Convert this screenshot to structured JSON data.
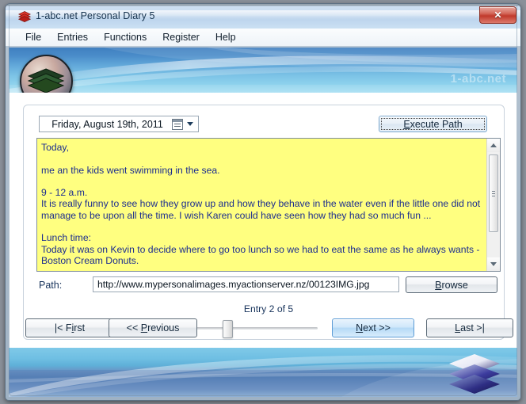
{
  "window": {
    "title": "1-abc.net Personal Diary 5",
    "app_icon": "stacked-layers-icon",
    "close_label": "✕"
  },
  "menubar": {
    "items": [
      {
        "label": "File"
      },
      {
        "label": "Entries"
      },
      {
        "label": "Functions"
      },
      {
        "label": "Register"
      },
      {
        "label": "Help"
      }
    ]
  },
  "banner": {
    "watermark": "1-abc.net",
    "logo_icon": "stacked-layers-logo"
  },
  "toolbar": {
    "date_value": "Friday, August 19th, 2011",
    "calendar_icon": "calendar-icon",
    "dropdown_icon": "chevron-down-icon",
    "execute_path_label": "Execute Path"
  },
  "editor": {
    "content": "Today,\n\nme an the kids went swimming in the sea.\n\n9 - 12 a.m.\nIt is really funny to see how they grow up and how they behave in the water even if the little one did not manage to be upon all the time. I wish Karen could have seen how they had so much fun ...\n\nLunch time:\nToday it was on Kevin to decide where to go too lunch so we had to eat the same as he always wants - Boston Cream Donuts.",
    "background_color": "#ffff80",
    "text_color": "#1c2d8f",
    "scroll_up_icon": "arrow-up-icon",
    "scroll_down_icon": "arrow-down-icon"
  },
  "path_row": {
    "label": "Path:",
    "value": "http://www.mypersonalimages.myactionserver.nz/00123IMG.jpg",
    "browse_label": "Browse"
  },
  "navigation": {
    "entry_status": "Entry 2 of 5",
    "current_entry": 2,
    "total_entries": 5,
    "slider_percent": 26,
    "first_label": "|< First",
    "previous_label": "<< Previous",
    "next_label": "Next >>",
    "last_label": "Last >|"
  },
  "colors": {
    "editor_bg": "#ffff80",
    "editor_text": "#1c2d8f",
    "default_button": "#5b9bd5",
    "close_button": "#c0392b",
    "banner_blue": "#63a9da"
  }
}
